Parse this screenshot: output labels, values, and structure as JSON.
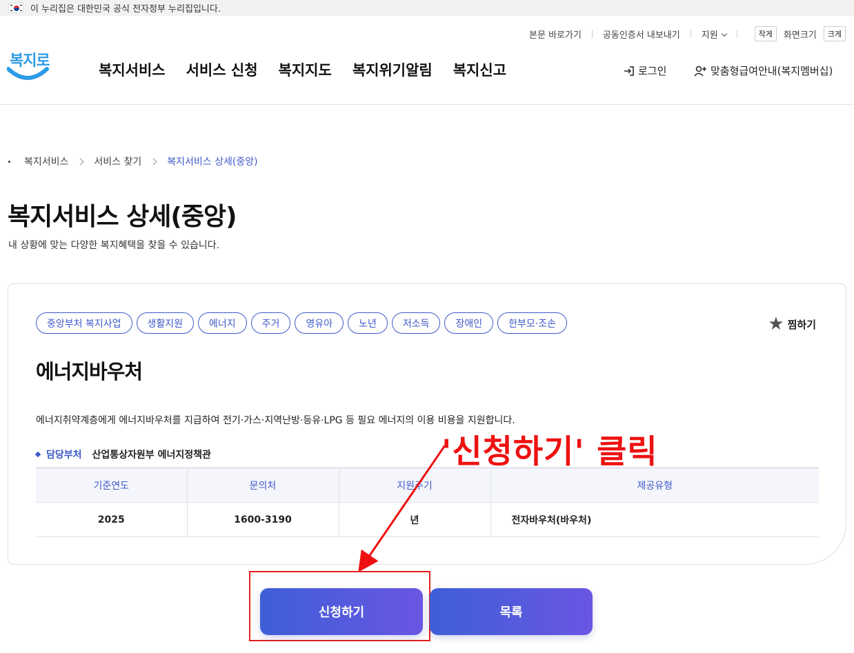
{
  "gov_banner": {
    "text": "이 누리집은 대한민국 공식 전자정부 누리집입니다."
  },
  "utility": {
    "skip": "본문 바로가기",
    "cert": "공동인증서 내보내기",
    "support": "지원",
    "small": "작게",
    "size_label": "화면크기",
    "large": "크게"
  },
  "logo": {
    "text": "복지로"
  },
  "gnb": [
    "복지서비스",
    "서비스 신청",
    "복지지도",
    "복지위기알림",
    "복지신고"
  ],
  "header": {
    "login": "로그인",
    "member": "맞춤형급여안내(복지멤버십)"
  },
  "breadcrumb": [
    "복지서비스",
    "서비스 찾기",
    "복지서비스 상세(중앙)"
  ],
  "page": {
    "title": "복지서비스 상세(중앙)",
    "subtitle": "내 상황에 맞는 다양한 복지혜택을 찾을 수 있습니다."
  },
  "service": {
    "tags": [
      "중앙부처 복지사업",
      "생활지원",
      "에너지",
      "주거",
      "영유아",
      "노년",
      "저소득",
      "장애인",
      "한부모·조손"
    ],
    "favorite": "찜하기",
    "title": "에너지바우처",
    "description": "에너지취약계층에게 에너지바우처를 지급하여 전기·가스·지역난방·등유·LPG 등 필요 에너지의 이용 비용을 지원합니다.",
    "dept_label": "담당부처",
    "dept_value": "산업통상자원부 에너지정책관",
    "table": {
      "headers": [
        "기준연도",
        "문의처",
        "지원주기",
        "제공유형"
      ],
      "row": [
        "2025",
        "1600-3190",
        "년",
        "전자바우처(바우처)"
      ]
    }
  },
  "buttons": {
    "apply": "신청하기",
    "list": "목록"
  },
  "annotation": {
    "text": "'신청하기' 클릭",
    "color": "#ee1111"
  },
  "colors": {
    "accent": "#3d59c8",
    "button_from": "#3e5fd6",
    "button_to": "#6a56e3"
  }
}
